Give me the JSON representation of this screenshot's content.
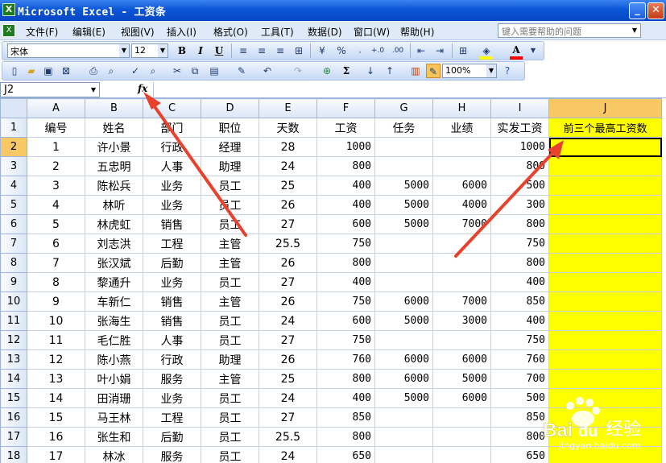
{
  "window": {
    "title": "Microsoft Excel - 工资条",
    "app_icon": "excel-icon",
    "buttons": [
      "minimize-icon",
      "maximize-icon",
      "close-icon"
    ]
  },
  "menubar": {
    "items": [
      "文件(F)",
      "编辑(E)",
      "视图(V)",
      "插入(I)",
      "格式(O)",
      "工具(T)",
      "数据(D)",
      "窗口(W)",
      "帮助(H)"
    ],
    "help_placeholder": "键入需要帮助的问题"
  },
  "format_toolbar": {
    "font": "宋体",
    "size": "12",
    "bold": "B",
    "italic": "I",
    "underline": "U",
    "currency": "%",
    "inc_decimal": "+.0",
    "dec_decimal": ".00",
    "fill_color": "#ffff00",
    "font_color": "#ff0000",
    "font_color_letter": "A"
  },
  "standard_toolbar": {
    "zoom": "100%",
    "sum": "Σ"
  },
  "formula_bar": {
    "cell_ref": "J2",
    "fx": "fx",
    "value": ""
  },
  "grid": {
    "columns": [
      "A",
      "B",
      "C",
      "D",
      "E",
      "F",
      "G",
      "H",
      "I",
      "J"
    ],
    "active_column": "J",
    "active_row": 2,
    "header_row": [
      "编号",
      "姓名",
      "部门",
      "职位",
      "天数",
      "工资",
      "任务",
      "业绩",
      "实发工资",
      "前三个最高工资数"
    ],
    "rows": [
      [
        "1",
        "许小景",
        "行政",
        "经理",
        "28",
        "1000",
        "",
        "",
        "1000",
        ""
      ],
      [
        "2",
        "五忠明",
        "人事",
        "助理",
        "24",
        "800",
        "",
        "",
        "800",
        ""
      ],
      [
        "3",
        "陈松兵",
        "业务",
        "员工",
        "25",
        "400",
        "5000",
        "6000",
        "500",
        ""
      ],
      [
        "4",
        "林听",
        "业务",
        "员工",
        "26",
        "400",
        "5000",
        "4000",
        "300",
        ""
      ],
      [
        "5",
        "林虎虹",
        "销售",
        "员工",
        "27",
        "600",
        "5000",
        "7000",
        "800",
        ""
      ],
      [
        "6",
        "刘志洪",
        "工程",
        "主管",
        "25.5",
        "750",
        "",
        "",
        "750",
        ""
      ],
      [
        "7",
        "张汉斌",
        "后勤",
        "主管",
        "26",
        "800",
        "",
        "",
        "800",
        ""
      ],
      [
        "8",
        "黎通升",
        "业务",
        "员工",
        "27",
        "400",
        "",
        "",
        "400",
        ""
      ],
      [
        "9",
        "车新仁",
        "销售",
        "主管",
        "26",
        "750",
        "6000",
        "7000",
        "850",
        ""
      ],
      [
        "10",
        "张海生",
        "销售",
        "员工",
        "24",
        "600",
        "5000",
        "3000",
        "400",
        ""
      ],
      [
        "11",
        "毛仁胜",
        "人事",
        "员工",
        "27",
        "750",
        "",
        "",
        "750",
        ""
      ],
      [
        "12",
        "陈小燕",
        "行政",
        "助理",
        "26",
        "760",
        "6000",
        "6000",
        "760",
        ""
      ],
      [
        "13",
        "叶小娟",
        "服务",
        "主管",
        "25",
        "800",
        "6000",
        "5000",
        "700",
        ""
      ],
      [
        "14",
        "田消珊",
        "业务",
        "员工",
        "24",
        "400",
        "5000",
        "6000",
        "500",
        ""
      ],
      [
        "15",
        "马王林",
        "工程",
        "员工",
        "27",
        "850",
        "",
        "",
        "850",
        ""
      ],
      [
        "16",
        "张生和",
        "后勤",
        "员工",
        "25.5",
        "800",
        "",
        "",
        "800",
        ""
      ],
      [
        "17",
        "林冰",
        "服务",
        "员工",
        "24",
        "650",
        "",
        "",
        "650",
        ""
      ]
    ]
  },
  "colors": {
    "highlight_column": "#ffff00",
    "annotation_arrow": "#e8412c",
    "title_bar": "#0a56d8"
  },
  "watermark": {
    "brand": "Bai",
    "brand2": "du",
    "text": "经验",
    "url": "jingyan.baidu.com"
  }
}
